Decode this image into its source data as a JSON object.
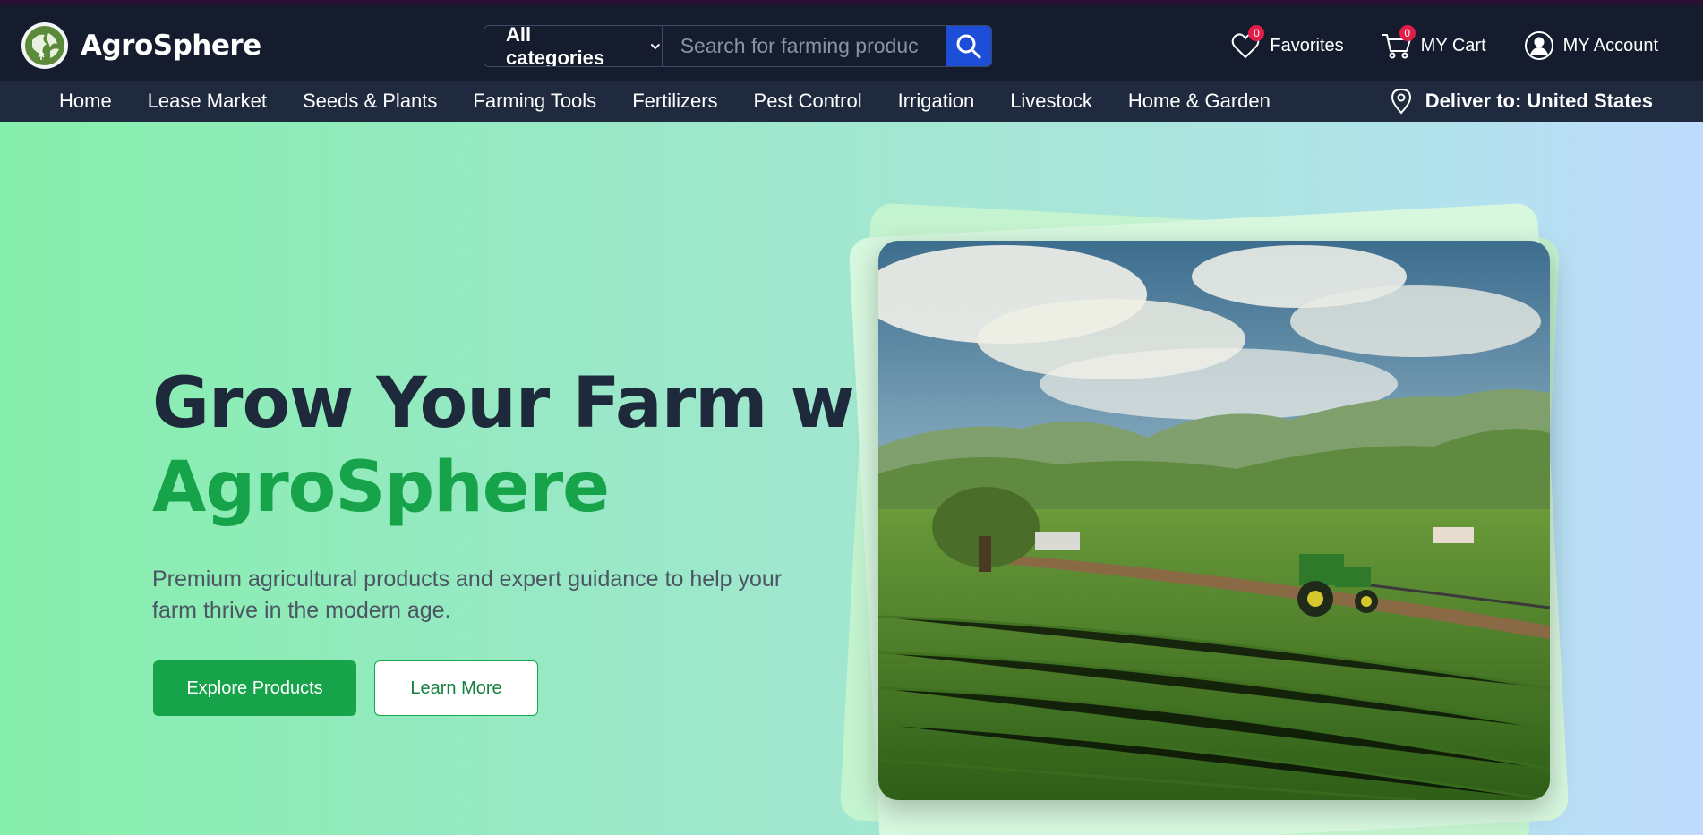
{
  "brand": {
    "name": "AgroSphere"
  },
  "search": {
    "category_label": "All categories",
    "placeholder": "Search for farming produc"
  },
  "header": {
    "favorites": {
      "label": "Favorites",
      "count": "0"
    },
    "cart": {
      "label": "MY Cart",
      "count": "0"
    },
    "account": {
      "label": "MY Account"
    }
  },
  "nav": {
    "items": [
      "Home",
      "Lease Market",
      "Seeds & Plants",
      "Farming Tools",
      "Fertilizers",
      "Pest Control",
      "Irrigation",
      "Livestock",
      "Home & Garden"
    ],
    "deliver": "Deliver to: United States"
  },
  "hero": {
    "headline_line1": "Grow Your Farm with",
    "headline_line2": "AgroSphere",
    "subtext": "Premium agricultural products and expert guidance to help your farm thrive in the modern age.",
    "primary_button": "Explore Products",
    "secondary_button": "Learn More"
  },
  "colors": {
    "header_bg": "#141c2e",
    "nav_bg": "#1f2a3f",
    "accent_green": "#16a34a",
    "search_button": "#1d4ed8",
    "badge": "#e11d48"
  },
  "icons": {
    "logo": "globe-leaf-icon",
    "dropdown": "chevron-down-icon",
    "search": "search-icon",
    "favorites": "heart-icon",
    "cart": "cart-icon",
    "account": "user-icon",
    "deliver": "map-pin-icon"
  }
}
